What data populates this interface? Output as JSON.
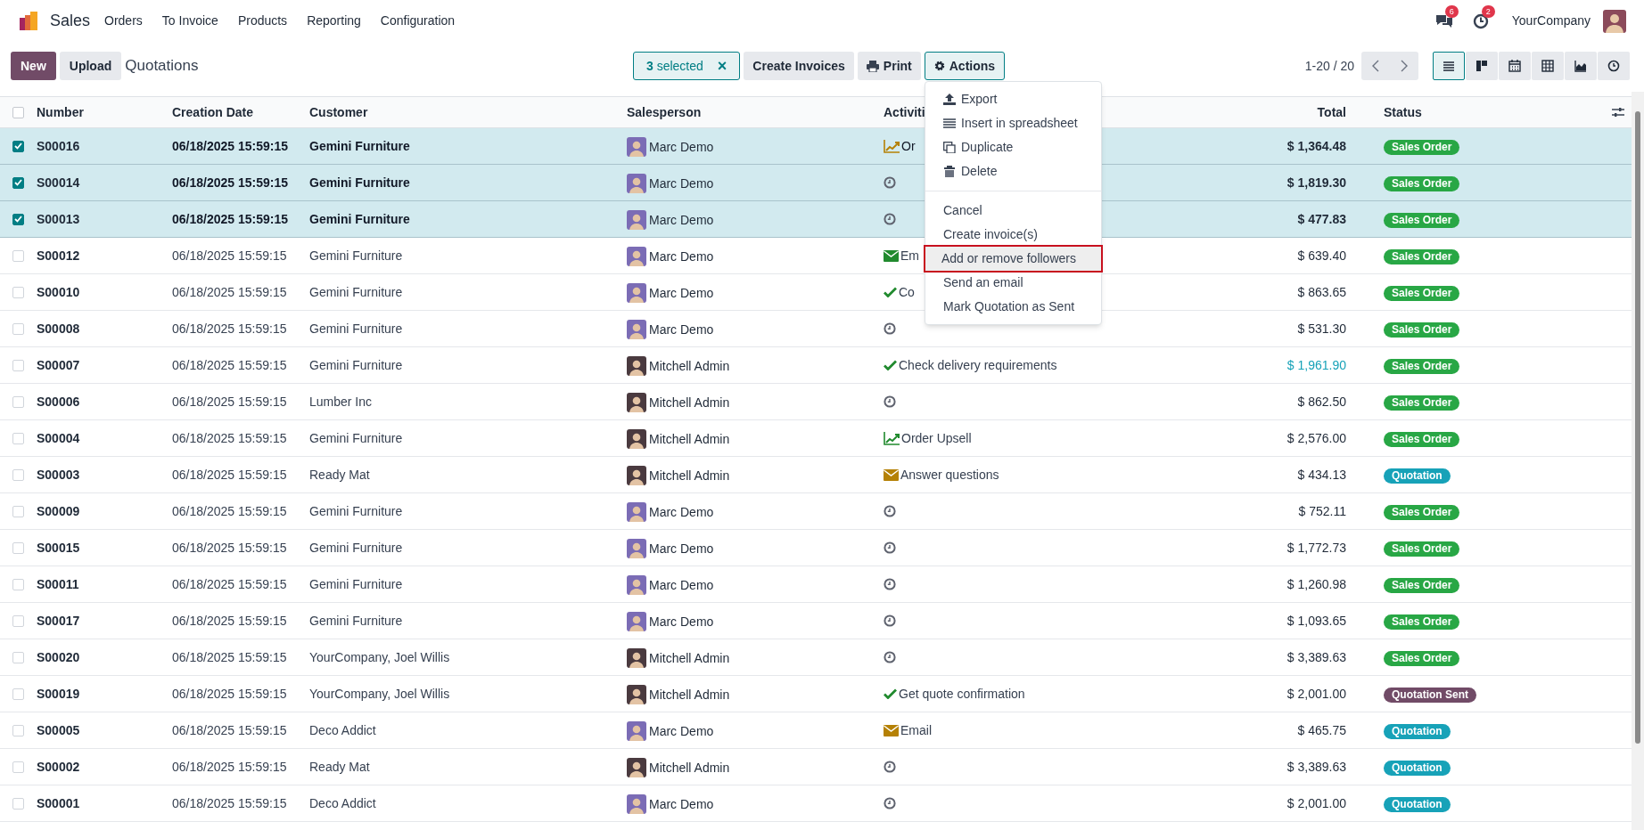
{
  "navbar": {
    "app": "Sales",
    "menu": [
      "Orders",
      "To Invoice",
      "Products",
      "Reporting",
      "Configuration"
    ],
    "messages_badge": "6",
    "activities_badge": "2",
    "company": "YourCompany"
  },
  "control_panel": {
    "buttons": [
      "New",
      "Upload"
    ],
    "title": "Quotations",
    "selection": "**3** selected",
    "clear": "×",
    "actions": [
      {
        "label": "Create Invoices",
        "kind": "plain",
        "active": false
      },
      {
        "label": "Print",
        "kind": "print",
        "active": false
      },
      {
        "label": "Actions",
        "kind": "gear",
        "active": true
      }
    ],
    "pager": "1-20 / 20",
    "views": [
      {
        "kind": "list",
        "selected": true
      },
      {
        "kind": "kanban",
        "selected": false
      },
      {
        "kind": "calendar",
        "selected": false
      },
      {
        "kind": "pivot",
        "selected": false
      },
      {
        "kind": "graph",
        "selected": false
      },
      {
        "kind": "activity",
        "selected": false
      }
    ]
  },
  "actions_menu": {
    "groups": [
      [
        {
          "label": "Export",
          "kind": "upload",
          "highlighted": false
        },
        {
          "label": "Insert in spreadsheet",
          "kind": "list",
          "highlighted": false
        },
        {
          "label": "Duplicate",
          "kind": "copy",
          "highlighted": false
        },
        {
          "label": "Delete",
          "kind": "trash",
          "highlighted": false
        }
      ],
      [
        {
          "label": "Cancel",
          "kind": "plain",
          "highlighted": false
        },
        {
          "label": "Create invoice(s)",
          "kind": "plain",
          "highlighted": false
        },
        {
          "label": "Add or remove followers",
          "kind": "plain",
          "highlighted": true
        },
        {
          "label": "Send an email",
          "kind": "plain",
          "highlighted": false
        },
        {
          "label": "Mark Quotation as Sent",
          "kind": "plain",
          "highlighted": false
        }
      ]
    ]
  },
  "table": {
    "select_all_checked": false,
    "columns": [
      "Number",
      "Creation Date",
      "Customer",
      "Salesperson",
      "Activiti",
      "Total",
      "Status"
    ],
    "rows": [
      {
        "number": "S00016",
        "date": "06/18/2025 15:59:15",
        "customer": "Gemini Furniture",
        "salesperson": {
          "name": "Marc Demo",
          "color": "#7b6cb5"
        },
        "activity": {
          "kind": "upsell",
          "color": "#b58105",
          "text": "Or"
        },
        "total": "$ 1,364.48",
        "total_highlighted": false,
        "status": {
          "label": "Sales Order",
          "color": "#28a745"
        },
        "selected": true
      },
      {
        "number": "S00014",
        "date": "06/18/2025 15:59:15",
        "customer": "Gemini Furniture",
        "salesperson": {
          "name": "Marc Demo",
          "color": "#7b6cb5"
        },
        "activity": {
          "kind": "clock",
          "color": "#5f636f"
        },
        "total": "$ 1,819.30",
        "total_highlighted": false,
        "status": {
          "label": "Sales Order",
          "color": "#28a745"
        },
        "selected": true
      },
      {
        "number": "S00013",
        "date": "06/18/2025 15:59:15",
        "customer": "Gemini Furniture",
        "salesperson": {
          "name": "Marc Demo",
          "color": "#7b6cb5"
        },
        "activity": {
          "kind": "clock",
          "color": "#5f636f"
        },
        "total": "$ 477.83",
        "total_highlighted": false,
        "status": {
          "label": "Sales Order",
          "color": "#28a745"
        },
        "selected": true
      },
      {
        "number": "S00012",
        "date": "06/18/2025 15:59:15",
        "customer": "Gemini Furniture",
        "salesperson": {
          "name": "Marc Demo",
          "color": "#7b6cb5"
        },
        "activity": {
          "kind": "email",
          "color": "#218a2e",
          "text": "Em"
        },
        "total": "$ 639.40",
        "total_highlighted": false,
        "status": {
          "label": "Sales Order",
          "color": "#28a745"
        },
        "selected": false
      },
      {
        "number": "S00010",
        "date": "06/18/2025 15:59:15",
        "customer": "Gemini Furniture",
        "salesperson": {
          "name": "Marc Demo",
          "color": "#7b6cb5"
        },
        "activity": {
          "kind": "check",
          "color": "#218a2e",
          "text": "Co"
        },
        "total": "$ 863.65",
        "total_highlighted": false,
        "status": {
          "label": "Sales Order",
          "color": "#28a745"
        },
        "selected": false
      },
      {
        "number": "S00008",
        "date": "06/18/2025 15:59:15",
        "customer": "Gemini Furniture",
        "salesperson": {
          "name": "Marc Demo",
          "color": "#7b6cb5"
        },
        "activity": {
          "kind": "clock",
          "color": "#5f636f"
        },
        "total": "$ 531.30",
        "total_highlighted": false,
        "status": {
          "label": "Sales Order",
          "color": "#28a745"
        },
        "selected": false
      },
      {
        "number": "S00007",
        "date": "06/18/2025 15:59:15",
        "customer": "Gemini Furniture",
        "salesperson": {
          "name": "Mitchell Admin",
          "color": "#4a3a3f"
        },
        "activity": {
          "kind": "check",
          "color": "#218a2e",
          "text": "Check delivery requirements"
        },
        "total": "$ 1,961.90",
        "total_highlighted": true,
        "status": {
          "label": "Sales Order",
          "color": "#28a745"
        },
        "selected": false
      },
      {
        "number": "S00006",
        "date": "06/18/2025 15:59:15",
        "customer": "Lumber Inc",
        "salesperson": {
          "name": "Mitchell Admin",
          "color": "#4a3a3f"
        },
        "activity": {
          "kind": "clock",
          "color": "#5f636f"
        },
        "total": "$ 862.50",
        "total_highlighted": false,
        "status": {
          "label": "Sales Order",
          "color": "#28a745"
        },
        "selected": false
      },
      {
        "number": "S00004",
        "date": "06/18/2025 15:59:15",
        "customer": "Gemini Furniture",
        "salesperson": {
          "name": "Mitchell Admin",
          "color": "#4a3a3f"
        },
        "activity": {
          "kind": "upsell",
          "color": "#218a2e",
          "text": "Order Upsell"
        },
        "total": "$ 2,576.00",
        "total_highlighted": false,
        "status": {
          "label": "Sales Order",
          "color": "#28a745"
        },
        "selected": false
      },
      {
        "number": "S00003",
        "date": "06/18/2025 15:59:15",
        "customer": "Ready Mat",
        "salesperson": {
          "name": "Mitchell Admin",
          "color": "#4a3a3f"
        },
        "activity": {
          "kind": "email",
          "color": "#b58105",
          "text": "Answer questions"
        },
        "total": "$ 434.13",
        "total_highlighted": false,
        "status": {
          "label": "Quotation",
          "color": "#17a2b8"
        },
        "selected": false
      },
      {
        "number": "S00009",
        "date": "06/18/2025 15:59:15",
        "customer": "Gemini Furniture",
        "salesperson": {
          "name": "Marc Demo",
          "color": "#7b6cb5"
        },
        "activity": {
          "kind": "clock",
          "color": "#5f636f"
        },
        "total": "$ 752.11",
        "total_highlighted": false,
        "status": {
          "label": "Sales Order",
          "color": "#28a745"
        },
        "selected": false
      },
      {
        "number": "S00015",
        "date": "06/18/2025 15:59:15",
        "customer": "Gemini Furniture",
        "salesperson": {
          "name": "Marc Demo",
          "color": "#7b6cb5"
        },
        "activity": {
          "kind": "clock",
          "color": "#5f636f"
        },
        "total": "$ 1,772.73",
        "total_highlighted": false,
        "status": {
          "label": "Sales Order",
          "color": "#28a745"
        },
        "selected": false
      },
      {
        "number": "S00011",
        "date": "06/18/2025 15:59:15",
        "customer": "Gemini Furniture",
        "salesperson": {
          "name": "Marc Demo",
          "color": "#7b6cb5"
        },
        "activity": {
          "kind": "clock",
          "color": "#5f636f"
        },
        "total": "$ 1,260.98",
        "total_highlighted": false,
        "status": {
          "label": "Sales Order",
          "color": "#28a745"
        },
        "selected": false
      },
      {
        "number": "S00017",
        "date": "06/18/2025 15:59:15",
        "customer": "Gemini Furniture",
        "salesperson": {
          "name": "Marc Demo",
          "color": "#7b6cb5"
        },
        "activity": {
          "kind": "clock",
          "color": "#5f636f"
        },
        "total": "$ 1,093.65",
        "total_highlighted": false,
        "status": {
          "label": "Sales Order",
          "color": "#28a745"
        },
        "selected": false
      },
      {
        "number": "S00020",
        "date": "06/18/2025 15:59:15",
        "customer": "YourCompany, Joel Willis",
        "salesperson": {
          "name": "Mitchell Admin",
          "color": "#4a3a3f"
        },
        "activity": {
          "kind": "clock",
          "color": "#5f636f"
        },
        "total": "$ 3,389.63",
        "total_highlighted": false,
        "status": {
          "label": "Sales Order",
          "color": "#28a745"
        },
        "selected": false
      },
      {
        "number": "S00019",
        "date": "06/18/2025 15:59:15",
        "customer": "YourCompany, Joel Willis",
        "salesperson": {
          "name": "Mitchell Admin",
          "color": "#4a3a3f"
        },
        "activity": {
          "kind": "check",
          "color": "#218a2e",
          "text": "Get quote confirmation"
        },
        "total": "$ 2,001.00",
        "total_highlighted": false,
        "status": {
          "label": "Quotation Sent",
          "color": "#714b67"
        },
        "selected": false
      },
      {
        "number": "S00005",
        "date": "06/18/2025 15:59:15",
        "customer": "Deco Addict",
        "salesperson": {
          "name": "Marc Demo",
          "color": "#7b6cb5"
        },
        "activity": {
          "kind": "email",
          "color": "#b58105",
          "text": "Email"
        },
        "total": "$ 465.75",
        "total_highlighted": false,
        "status": {
          "label": "Quotation",
          "color": "#17a2b8"
        },
        "selected": false
      },
      {
        "number": "S00002",
        "date": "06/18/2025 15:59:15",
        "customer": "Ready Mat",
        "salesperson": {
          "name": "Mitchell Admin",
          "color": "#4a3a3f"
        },
        "activity": {
          "kind": "clock",
          "color": "#5f636f"
        },
        "total": "$ 3,389.63",
        "total_highlighted": false,
        "status": {
          "label": "Quotation",
          "color": "#17a2b8"
        },
        "selected": false
      },
      {
        "number": "S00001",
        "date": "06/18/2025 15:59:15",
        "customer": "Deco Addict",
        "salesperson": {
          "name": "Marc Demo",
          "color": "#7b6cb5"
        },
        "activity": {
          "kind": "clock",
          "color": "#5f636f"
        },
        "total": "$ 2,001.00",
        "total_highlighted": false,
        "status": {
          "label": "Quotation",
          "color": "#17a2b8"
        },
        "selected": false
      }
    ]
  }
}
